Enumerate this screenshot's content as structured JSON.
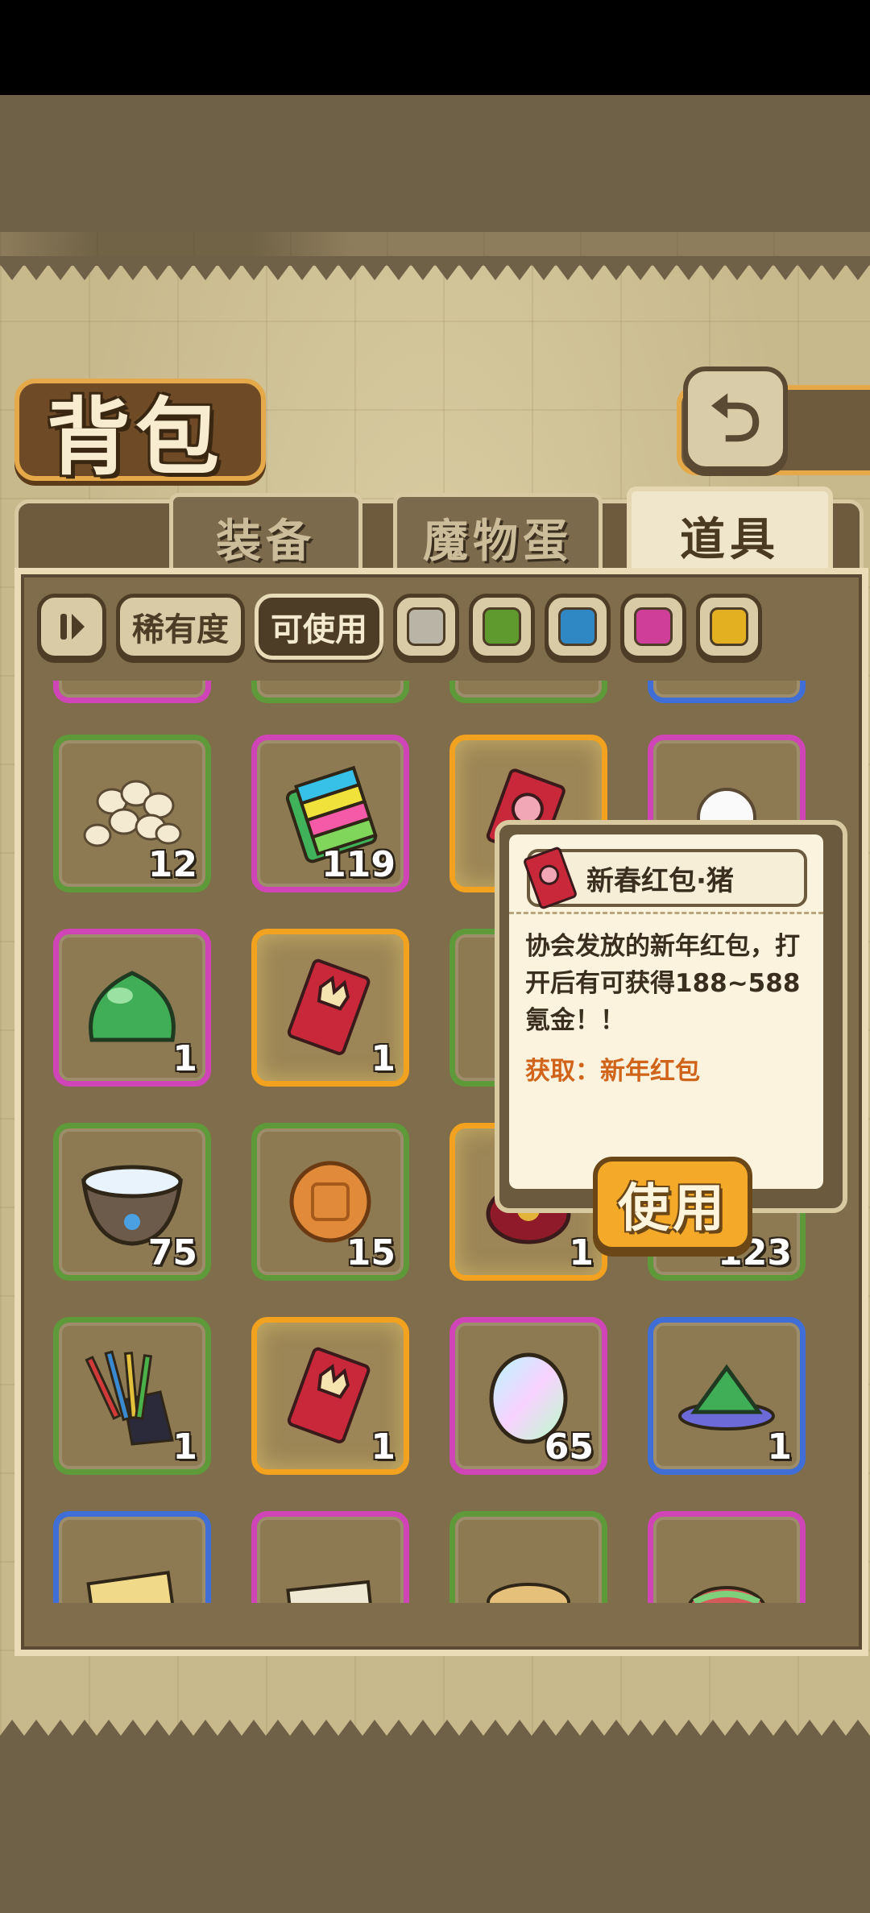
{
  "header": {
    "title": "背包"
  },
  "tabs": [
    {
      "label": "装备",
      "active": false
    },
    {
      "label": "魔物蛋",
      "active": false
    },
    {
      "label": "道具",
      "active": true
    }
  ],
  "filters": {
    "sort_icon": "pause-sort-icon",
    "rarity_label": "稀有度",
    "usable_label": "可使用",
    "swatches": [
      "#b9b4a6",
      "#5f9a2e",
      "#2f88c4",
      "#cf3f9a",
      "#e3b021"
    ]
  },
  "items": [
    {
      "icon": "lotus-seeds-icon",
      "qty": "12",
      "rarity": "green"
    },
    {
      "icon": "rainbow-book-icon",
      "qty": "119",
      "rarity": "pink"
    },
    {
      "icon": "red-envelope-pig-icon",
      "qty": "",
      "rarity": "gold"
    },
    {
      "icon": "white-ball-icon",
      "qty": "",
      "rarity": "pink"
    },
    {
      "icon": "green-slime-icon",
      "qty": "1",
      "rarity": "pink"
    },
    {
      "icon": "anniversary-envelope-icon",
      "qty": "1",
      "rarity": "gold"
    },
    {
      "icon": "hidden-item-icon",
      "qty": "",
      "rarity": "green"
    },
    {
      "icon": "hidden-item-icon",
      "qty": "",
      "rarity": "green"
    },
    {
      "icon": "water-bowl-icon",
      "qty": "75",
      "rarity": "green"
    },
    {
      "icon": "mooncake-icon",
      "qty": "15",
      "rarity": "green"
    },
    {
      "icon": "lucky-bag-icon",
      "qty": "1",
      "rarity": "gold"
    },
    {
      "icon": "herb-icon",
      "qty": "123",
      "rarity": "green"
    },
    {
      "icon": "chopsticks-icon",
      "qty": "1",
      "rarity": "green"
    },
    {
      "icon": "anniversary-envelope-icon",
      "qty": "1",
      "rarity": "gold"
    },
    {
      "icon": "rainbow-egg-icon",
      "qty": "65",
      "rarity": "pink"
    },
    {
      "icon": "zongzi-icon",
      "qty": "1",
      "rarity": "blue"
    },
    {
      "icon": "card-icon",
      "qty": "",
      "rarity": "blue"
    },
    {
      "icon": "banknotes-icon",
      "qty": "",
      "rarity": "pink"
    },
    {
      "icon": "basket-icon",
      "qty": "",
      "rarity": "green"
    },
    {
      "icon": "meat-icon",
      "qty": "",
      "rarity": "pink"
    }
  ],
  "popup": {
    "title": "新春红包·猪",
    "description": "协会发放的新年红包，打开后有可获得188~588氪金！！",
    "source": "获取：新年红包",
    "use_label": "使用"
  }
}
